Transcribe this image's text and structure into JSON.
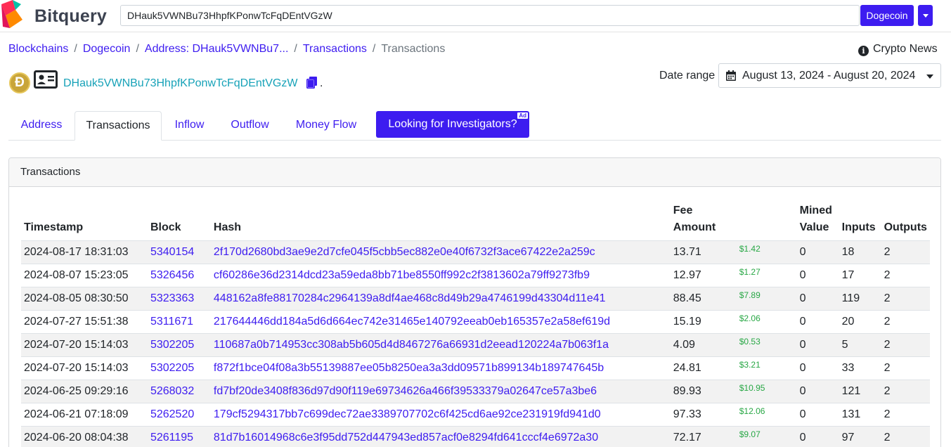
{
  "header": {
    "brand": "Bitquery",
    "search_value": "DHauk5VWNBu73HhpfKPonwTcFqDEntVGzW",
    "network_label": "Dogecoin"
  },
  "breadcrumb": {
    "items": [
      "Blockchains",
      "Dogecoin",
      "Address: DHauk5VWNBu7...",
      "Transactions"
    ],
    "current": "Transactions"
  },
  "news_label": "Crypto News",
  "address": {
    "value": "DHauk5VWNBu73HhpfKPonwTcFqDEntVGzW",
    "coin_symbol": "Đ",
    "trailing": "."
  },
  "date_range": {
    "label": "Date range",
    "value": "August 13, 2024 - August 20, 2024"
  },
  "tabs": [
    {
      "label": "Address"
    },
    {
      "label": "Transactions"
    },
    {
      "label": "Inflow"
    },
    {
      "label": "Outflow"
    },
    {
      "label": "Money Flow"
    }
  ],
  "investigate": {
    "label": "Looking for Investigators?",
    "badge": "Ad"
  },
  "card": {
    "title": "Transactions",
    "headers": {
      "timestamp": "Timestamp",
      "block": "Block",
      "hash": "Hash",
      "fee_line1": "Fee",
      "fee_line2": "Amount",
      "mined_line1": "Mined",
      "mined_line2": "Value",
      "inputs": "Inputs",
      "outputs": "Outputs"
    },
    "rows": [
      {
        "timestamp": "2024-08-17 18:31:03",
        "block": "5340154",
        "hash": "2f170d2680bd3ae9e2d7cfe045f5cbb5ec882e0e40f6732f3ace67422e2a259c",
        "fee": "13.71",
        "usd": "$1.42",
        "mined": "0",
        "inputs": "18",
        "outputs": "2"
      },
      {
        "timestamp": "2024-08-07 15:23:05",
        "block": "5326456",
        "hash": "cf60286e36d2314dcd23a59eda8bb71be8550ff992c2f3813602a79ff9273fb9",
        "fee": "12.97",
        "usd": "$1.27",
        "mined": "0",
        "inputs": "17",
        "outputs": "2"
      },
      {
        "timestamp": "2024-08-05 08:30:50",
        "block": "5323363",
        "hash": "448162a8fe88170284c2964139a8df4ae468c8d49b29a4746199d43304d11e41",
        "fee": "88.45",
        "usd": "$7.89",
        "mined": "0",
        "inputs": "119",
        "outputs": "2"
      },
      {
        "timestamp": "2024-07-27 15:51:38",
        "block": "5311671",
        "hash": "217644446dd184a5d6d664ec742e31465e140792eeab0eb165357e2a58ef619d",
        "fee": "15.19",
        "usd": "$2.06",
        "mined": "0",
        "inputs": "20",
        "outputs": "2"
      },
      {
        "timestamp": "2024-07-20 15:14:03",
        "block": "5302205",
        "hash": "110687a0b714953cc308ab5b605d4d8467276a66931d2eead120224a7b063f1a",
        "fee": "4.09",
        "usd": "$0.53",
        "mined": "0",
        "inputs": "5",
        "outputs": "2"
      },
      {
        "timestamp": "2024-07-20 15:14:03",
        "block": "5302205",
        "hash": "f872f1bce04f08a3b55139887ee05b8250ea3a3dd09571b899134b189747645b",
        "fee": "24.81",
        "usd": "$3.21",
        "mined": "0",
        "inputs": "33",
        "outputs": "2"
      },
      {
        "timestamp": "2024-06-25 09:29:16",
        "block": "5268032",
        "hash": "fd7bf20de3408f836d97d90f119e69734626a466f39533379a02647ce57a3be6",
        "fee": "89.93",
        "usd": "$10.95",
        "mined": "0",
        "inputs": "121",
        "outputs": "2"
      },
      {
        "timestamp": "2024-06-21 07:18:09",
        "block": "5262520",
        "hash": "179cf5294317bb7c699dec72ae3389707702c6f425cd6ae92ce231919fd941d0",
        "fee": "97.33",
        "usd": "$12.06",
        "mined": "0",
        "inputs": "131",
        "outputs": "2"
      },
      {
        "timestamp": "2024-06-20 08:04:38",
        "block": "5261195",
        "hash": "81d7b16014968c6e3f95dd752d447943ed857acf0e8294fd641cccf4e6972a30",
        "fee": "72.17",
        "usd": "$9.07",
        "mined": "0",
        "inputs": "97",
        "outputs": "2"
      }
    ]
  },
  "colors": {
    "accent": "#3d1cf0",
    "address_link": "#17a2b8",
    "usd_green": "#28a745"
  }
}
